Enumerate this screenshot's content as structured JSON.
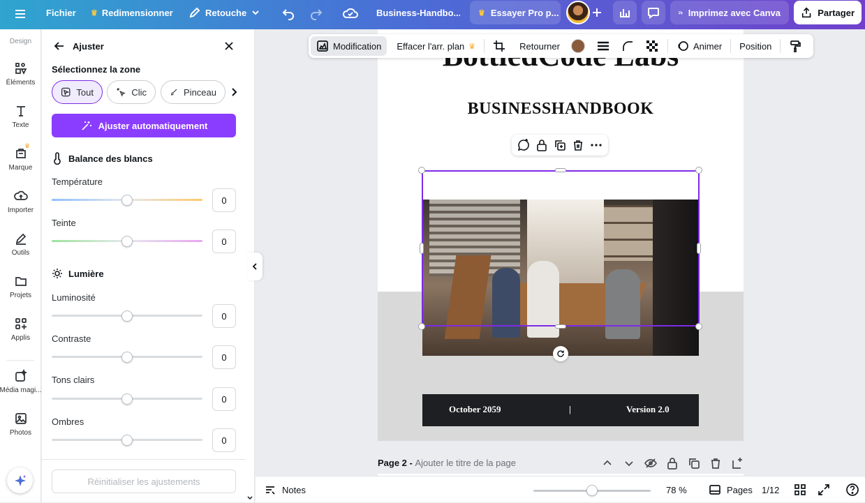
{
  "topbar": {
    "menu_label": "Fichier",
    "resize_label": "Redimensionner",
    "retouch_label": "Retouche",
    "doc_title": "Business-Handbo...",
    "try_pro_label": "Essayer Pro p...",
    "print_label": "Imprimez avec Canva",
    "share_label": "Partager"
  },
  "rail": {
    "header": "Design",
    "items": [
      {
        "label": "Éléments",
        "icon": "elements-icon"
      },
      {
        "label": "Texte",
        "icon": "text-icon"
      },
      {
        "label": "Marque",
        "icon": "brand-icon"
      },
      {
        "label": "Importer",
        "icon": "upload-icon"
      },
      {
        "label": "Outils",
        "icon": "draw-icon"
      },
      {
        "label": "Projets",
        "icon": "folder-icon"
      },
      {
        "label": "Applis",
        "icon": "apps-icon"
      },
      {
        "label": "Média magi...",
        "icon": "magic-media-icon"
      },
      {
        "label": "Photos",
        "icon": "photos-icon"
      }
    ]
  },
  "panel": {
    "title": "Ajuster",
    "zone_title": "Sélectionnez la zone",
    "zones": [
      "Tout",
      "Clic",
      "Pinceau"
    ],
    "selected_zone": "Tout",
    "auto_adjust": "Ajuster automatiquement",
    "white_balance_title": "Balance des blancs",
    "light_title": "Lumière",
    "sliders": [
      {
        "label": "Température",
        "value": "0"
      },
      {
        "label": "Teinte",
        "value": "0"
      },
      {
        "label": "Luminosité",
        "value": "0"
      },
      {
        "label": "Contraste",
        "value": "0"
      },
      {
        "label": "Tons clairs",
        "value": "0"
      },
      {
        "label": "Ombres",
        "value": "0"
      }
    ],
    "reset_label": "Réinitialiser les ajustements"
  },
  "context_toolbar": {
    "edit_label": "Modification",
    "bg_remove_label": "Effacer l'arr. plan",
    "flip_label": "Retourner",
    "animate_label": "Animer",
    "position_label": "Position",
    "color_swatch": "#8a5a3c"
  },
  "page": {
    "heading_partial": "BottledCode Labs",
    "subheading": "BUSINESSHANDBOOK",
    "footer_date": "October 2059",
    "footer_divider": "|",
    "footer_version": "Version 2.0",
    "page_label": "Page 2 - ",
    "page_title_placeholder": "Ajouter le titre de la page"
  },
  "bottombar": {
    "notes_label": "Notes",
    "zoom_label": "78 %",
    "zoom_value": 0.5,
    "pages_label": "Pages",
    "page_counter": "1/12"
  },
  "colors": {
    "accent": "#7d2ae8",
    "footer_band": "#1e1f22",
    "page_lower": "#d9d9d9"
  }
}
